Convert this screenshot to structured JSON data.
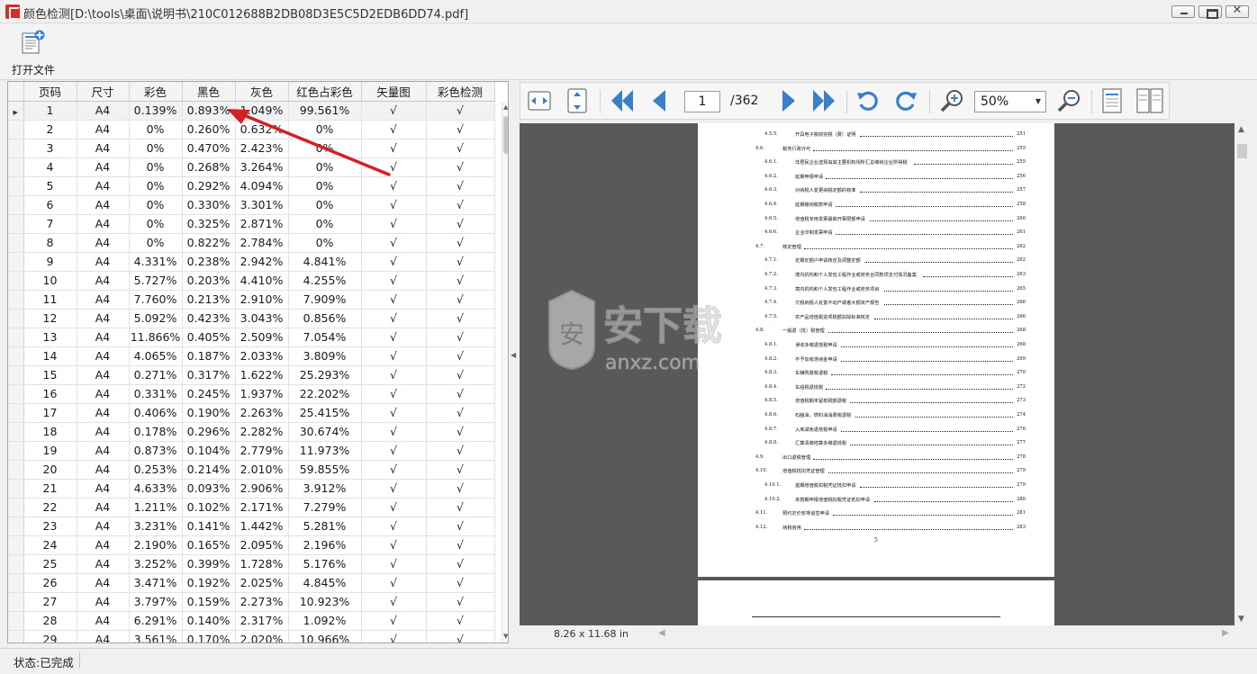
{
  "window": {
    "title": "颜色检测[D:\\tools\\桌面\\说明书\\210C012688B2DB08D3E5C5D2EDB6DD74.pdf]",
    "minimize": "—",
    "maximize": "□",
    "close": "✕"
  },
  "toolbar": {
    "open_label": "打开文件",
    "open_icon": "document-add-icon"
  },
  "table": {
    "columns": [
      "页码",
      "尺寸",
      "彩色",
      "黑色",
      "灰色",
      "红色占彩色",
      "矢量图",
      "彩色检测"
    ],
    "selected_row": 0,
    "rows": [
      [
        "1",
        "A4",
        "0.139%",
        "0.893%",
        "1.049%",
        "99.561%",
        "√",
        "√"
      ],
      [
        "2",
        "A4",
        "0%",
        "0.260%",
        "0.632%",
        "0%",
        "√",
        "√"
      ],
      [
        "3",
        "A4",
        "0%",
        "0.470%",
        "2.423%",
        "0%",
        "√",
        "√"
      ],
      [
        "4",
        "A4",
        "0%",
        "0.268%",
        "3.264%",
        "0%",
        "√",
        "√"
      ],
      [
        "5",
        "A4",
        "0%",
        "0.292%",
        "4.094%",
        "0%",
        "√",
        "√"
      ],
      [
        "6",
        "A4",
        "0%",
        "0.330%",
        "3.301%",
        "0%",
        "√",
        "√"
      ],
      [
        "7",
        "A4",
        "0%",
        "0.325%",
        "2.871%",
        "0%",
        "√",
        "√"
      ],
      [
        "8",
        "A4",
        "0%",
        "0.822%",
        "2.784%",
        "0%",
        "√",
        "√"
      ],
      [
        "9",
        "A4",
        "4.331%",
        "0.238%",
        "2.942%",
        "4.841%",
        "√",
        "√"
      ],
      [
        "10",
        "A4",
        "5.727%",
        "0.203%",
        "4.410%",
        "4.255%",
        "√",
        "√"
      ],
      [
        "11",
        "A4",
        "7.760%",
        "0.213%",
        "2.910%",
        "7.909%",
        "√",
        "√"
      ],
      [
        "12",
        "A4",
        "5.092%",
        "0.423%",
        "3.043%",
        "0.856%",
        "√",
        "√"
      ],
      [
        "13",
        "A4",
        "11.866%",
        "0.405%",
        "2.509%",
        "7.054%",
        "√",
        "√"
      ],
      [
        "14",
        "A4",
        "4.065%",
        "0.187%",
        "2.033%",
        "3.809%",
        "√",
        "√"
      ],
      [
        "15",
        "A4",
        "0.271%",
        "0.317%",
        "1.622%",
        "25.293%",
        "√",
        "√"
      ],
      [
        "16",
        "A4",
        "0.331%",
        "0.245%",
        "1.937%",
        "22.202%",
        "√",
        "√"
      ],
      [
        "17",
        "A4",
        "0.406%",
        "0.190%",
        "2.263%",
        "25.415%",
        "√",
        "√"
      ],
      [
        "18",
        "A4",
        "0.178%",
        "0.296%",
        "2.282%",
        "30.674%",
        "√",
        "√"
      ],
      [
        "19",
        "A4",
        "0.873%",
        "0.104%",
        "2.779%",
        "11.973%",
        "√",
        "√"
      ],
      [
        "20",
        "A4",
        "0.253%",
        "0.214%",
        "2.010%",
        "59.855%",
        "√",
        "√"
      ],
      [
        "21",
        "A4",
        "4.633%",
        "0.093%",
        "2.906%",
        "3.912%",
        "√",
        "√"
      ],
      [
        "22",
        "A4",
        "1.211%",
        "0.102%",
        "2.171%",
        "7.279%",
        "√",
        "√"
      ],
      [
        "23",
        "A4",
        "3.231%",
        "0.141%",
        "1.442%",
        "5.281%",
        "√",
        "√"
      ],
      [
        "24",
        "A4",
        "2.190%",
        "0.165%",
        "2.095%",
        "2.196%",
        "√",
        "√"
      ],
      [
        "25",
        "A4",
        "3.252%",
        "0.399%",
        "1.728%",
        "5.176%",
        "√",
        "√"
      ],
      [
        "26",
        "A4",
        "3.471%",
        "0.192%",
        "2.025%",
        "4.845%",
        "√",
        "√"
      ],
      [
        "27",
        "A4",
        "3.797%",
        "0.159%",
        "2.273%",
        "10.923%",
        "√",
        "√"
      ],
      [
        "28",
        "A4",
        "6.291%",
        "0.140%",
        "2.317%",
        "1.092%",
        "√",
        "√"
      ],
      [
        "29",
        "A4",
        "3.561%",
        "0.170%",
        "2.020%",
        "10.966%",
        "√",
        "√"
      ]
    ]
  },
  "viewer": {
    "current_page": "1",
    "total_pages": "/362",
    "zoom": "50%",
    "page_size": "8.26 x 11.68 in",
    "icons": [
      "fit-width-icon",
      "fit-height-icon",
      "first-page-icon",
      "prev-page-icon",
      "next-page-icon",
      "last-page-icon",
      "rotate-left-icon",
      "rotate-right-icon",
      "zoom-in-icon",
      "zoom-out-icon",
      "single-page-icon",
      "two-page-icon"
    ],
    "toc": [
      {
        "num": "4.5.5.",
        "text": "开具电子税收完税（费）证明",
        "page": "251",
        "indent": 1
      },
      {
        "num": "4.6.",
        "text": "税务行政许可",
        "page": "255",
        "indent": 0
      },
      {
        "num": "4.6.1.",
        "text": "非居民企业选择由其主要机构场所汇总缴纳企业所得税",
        "page": "255",
        "indent": 1
      },
      {
        "num": "4.6.2.",
        "text": "延期申报申请",
        "page": "256",
        "indent": 1
      },
      {
        "num": "4.6.3.",
        "text": "对纳税人变更纳税定额的核准",
        "page": "257",
        "indent": 1
      },
      {
        "num": "4.6.4.",
        "text": "延期缴纳税款申请",
        "page": "258",
        "indent": 1
      },
      {
        "num": "4.6.5.",
        "text": "增值税专用发票最高开票限额申请",
        "page": "260",
        "indent": 1
      },
      {
        "num": "4.6.6.",
        "text": "企业印制发票申请",
        "page": "261",
        "indent": 1
      },
      {
        "num": "4.7.",
        "text": "核定管理",
        "page": "262",
        "indent": 0
      },
      {
        "num": "4.7.1.",
        "text": "定期定额户申请核定及调整定额",
        "page": "262",
        "indent": 1
      },
      {
        "num": "4.7.2.",
        "text": "境内机构和个人发包工程作业或劳务合同款项支付情况备案",
        "page": "263",
        "indent": 1
      },
      {
        "num": "4.7.3.",
        "text": "境内机构和个人发包工程作业或劳务项目",
        "page": "265",
        "indent": 1
      },
      {
        "num": "4.7.4.",
        "text": "欠税纳税人处置不动产或者大额资产报告",
        "page": "266",
        "indent": 1
      },
      {
        "num": "4.7.5.",
        "text": "农产品增值税进项税额扣除标准核定",
        "page": "266",
        "indent": 1
      },
      {
        "num": "4.8.",
        "text": "一般退（抵）税管理",
        "page": "268",
        "indent": 0
      },
      {
        "num": "4.8.1.",
        "text": "误收多缴退抵税申请",
        "page": "268",
        "indent": 1
      },
      {
        "num": "4.8.2.",
        "text": "不予加收滞纳金申请",
        "page": "269",
        "indent": 1
      },
      {
        "num": "4.8.3.",
        "text": "车辆购置税退税",
        "page": "270",
        "indent": 1
      },
      {
        "num": "4.8.4.",
        "text": "车船税退抵税",
        "page": "272",
        "indent": 1
      },
      {
        "num": "4.8.5.",
        "text": "增值税期末留抵税额退税",
        "page": "273",
        "indent": 1
      },
      {
        "num": "4.8.6.",
        "text": "石脑油、燃料油消费税退税",
        "page": "274",
        "indent": 1
      },
      {
        "num": "4.8.7.",
        "text": "入库减免退抵税申请",
        "page": "276",
        "indent": 1
      },
      {
        "num": "4.8.8.",
        "text": "汇算清缴结算多缴退抵税",
        "page": "277",
        "indent": 1
      },
      {
        "num": "4.9.",
        "text": "出口退税管理",
        "page": "278",
        "indent": 0
      },
      {
        "num": "4.10.",
        "text": "增值税抵扣凭证管理",
        "page": "279",
        "indent": 0
      },
      {
        "num": "4.10.1.",
        "text": "逾期增值税扣税凭证抵扣申请",
        "page": "279",
        "indent": 1
      },
      {
        "num": "4.10.2.",
        "text": "未按期申报增值税扣税凭证抵扣申请",
        "page": "280",
        "indent": 1
      },
      {
        "num": "4.11.",
        "text": "预约定价安排谈签申请",
        "page": "281",
        "indent": 0
      },
      {
        "num": "4.12.",
        "text": "纳税信用",
        "page": "283",
        "indent": 0
      }
    ],
    "footer_page_number": "5"
  },
  "watermark": {
    "text": "安下载",
    "subtext": "anxz.com"
  },
  "status": {
    "text": "状态:已完成"
  },
  "colors": {
    "accent": "#3a7fc8",
    "annotation": "#d42020",
    "viewer_bg": "#595959"
  }
}
